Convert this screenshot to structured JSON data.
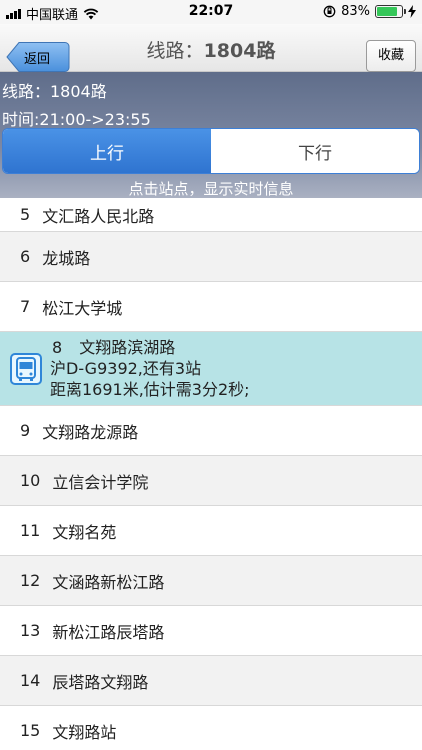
{
  "status_bar": {
    "carrier": "中国联通",
    "time": "22:07",
    "battery": "83%",
    "battery_level": 0.83
  },
  "nav": {
    "back_label": "返回",
    "title_prefix": "线路：",
    "title_route": "1804路",
    "favorite_label": "收藏"
  },
  "info": {
    "route_line": "线路：1804路",
    "time_line": "时间:21:00->23:55",
    "tab_up": "上行",
    "tab_down": "下行",
    "hint": "点击站点，显示实时信息"
  },
  "stops": [
    {
      "num": "5",
      "name": "文汇路人民北路"
    },
    {
      "num": "6",
      "name": "龙城路"
    },
    {
      "num": "7",
      "name": "松江大学城"
    },
    {
      "num": "8",
      "name": "文翔路滨湖路",
      "bus_plate_line": "沪D-G9392,还有3站",
      "bus_distance_line": "距离1691米,估计需3分2秒;"
    },
    {
      "num": "9",
      "name": "文翔路龙源路"
    },
    {
      "num": "10",
      "name": "立信会计学院"
    },
    {
      "num": "11",
      "name": "文翔名苑"
    },
    {
      "num": "12",
      "name": "文涵路新松江路"
    },
    {
      "num": "13",
      "name": "新松江路辰塔路"
    },
    {
      "num": "14",
      "name": "辰塔路文翔路"
    },
    {
      "num": "15",
      "name": "文翔路站"
    }
  ],
  "colors": {
    "accent": "#2f74d0",
    "bus_highlight": "#b7e3e6",
    "battery": "#35c759"
  }
}
